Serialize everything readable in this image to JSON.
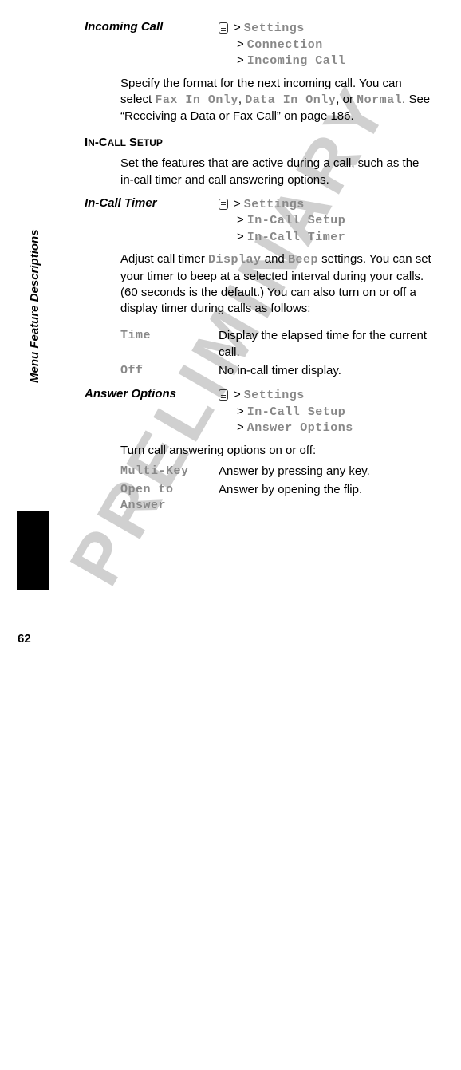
{
  "watermark": "PRELIMINARY",
  "sidebar": "Menu Feature Descriptions",
  "pageNumber": "62",
  "features": {
    "incomingCall": {
      "title": "Incoming Call",
      "path": [
        "Settings",
        "Connection",
        "Incoming Call"
      ],
      "body_pre": "Specify the format for the next incoming call. You can select ",
      "opt1": "Fax In Only",
      "sep1": ", ",
      "opt2": "Data In Only",
      "sep2": ", or ",
      "opt3": "Normal",
      "body_post": ". See “Receiving a Data or Fax Call” on page 186."
    },
    "inCallSetup": {
      "header": "IN-CALL SETUP",
      "intro": "Set the features that are active during a call, such as the in-call timer and call answering options."
    },
    "inCallTimer": {
      "title": "In-Call Timer",
      "path": [
        "Settings",
        "In-Call Setup",
        "In-Call Timer"
      ],
      "body_pre": "Adjust call timer ",
      "kw1": "Display",
      "mid": " and ",
      "kw2": "Beep",
      "body_post": " settings. You can set your timer to beep at a selected interval during your calls. (60 seconds is the default.) You can also turn on or off a display timer during calls as follows:",
      "options": [
        {
          "name": "Time",
          "desc": "Display the elapsed time for the current call."
        },
        {
          "name": "Off",
          "desc": "No in-call timer display."
        }
      ]
    },
    "answerOptions": {
      "title": "Answer Options",
      "path": [
        "Settings",
        "In-Call Setup",
        "Answer Options"
      ],
      "intro": "Turn call answering options on or off:",
      "options": [
        {
          "name": "Multi-Key",
          "desc": "Answer by pressing any key."
        },
        {
          "name": "Open to Answer",
          "desc": "Answer by opening the flip."
        }
      ]
    }
  }
}
